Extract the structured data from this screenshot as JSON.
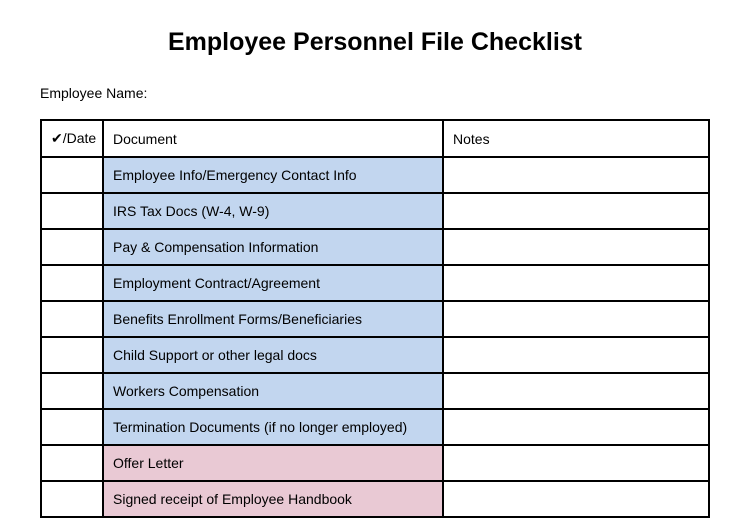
{
  "title": "Employee Personnel File Checklist",
  "nameLabel": "Employee Name:",
  "headers": {
    "check": "✔/Date",
    "document": "Document",
    "notes": "Notes"
  },
  "rows": [
    {
      "document": "Employee Info/Emergency Contact Info",
      "color": "blue",
      "check": "",
      "notes": ""
    },
    {
      "document": "IRS Tax Docs (W-4, W-9)",
      "color": "blue",
      "check": "",
      "notes": ""
    },
    {
      "document": "Pay & Compensation Information",
      "color": "blue",
      "check": "",
      "notes": ""
    },
    {
      "document": "Employment Contract/Agreement",
      "color": "blue",
      "check": "",
      "notes": ""
    },
    {
      "document": "Benefits Enrollment Forms/Beneficiaries",
      "color": "blue",
      "check": "",
      "notes": ""
    },
    {
      "document": "Child Support or other legal docs",
      "color": "blue",
      "check": "",
      "notes": ""
    },
    {
      "document": "Workers Compensation",
      "color": "blue",
      "check": "",
      "notes": ""
    },
    {
      "document": "Termination Documents (if no longer employed)",
      "color": "blue",
      "check": "",
      "notes": ""
    },
    {
      "document": "Offer Letter",
      "color": "pink",
      "check": "",
      "notes": ""
    },
    {
      "document": "Signed receipt of Employee Handbook",
      "color": "pink",
      "check": "",
      "notes": ""
    }
  ]
}
